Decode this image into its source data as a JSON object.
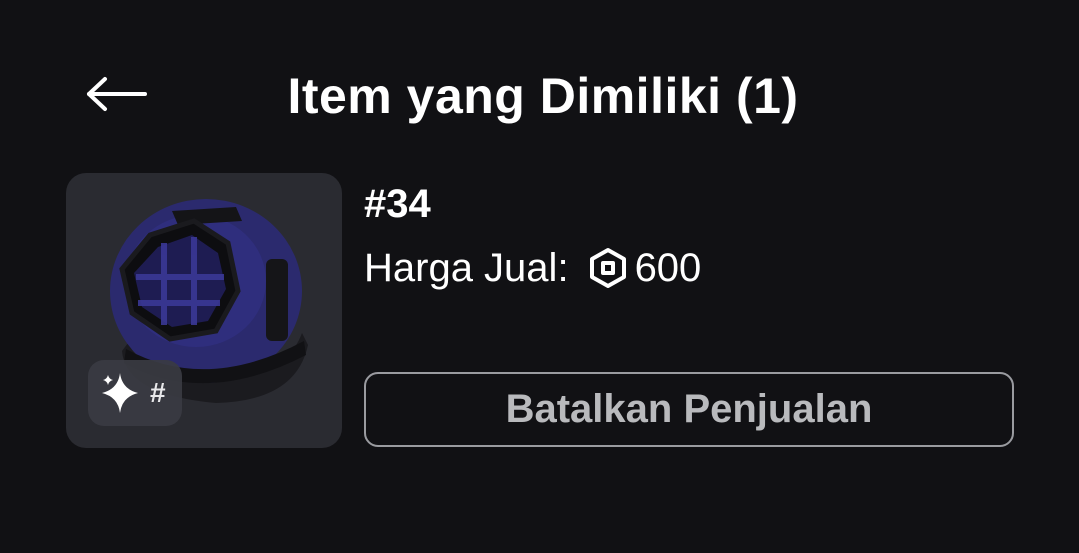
{
  "header": {
    "back_icon": "arrow-left-icon",
    "title": "Item yang Dimiliki (1)"
  },
  "item": {
    "thumbnail_icon": "diving-helmet-image",
    "badge_icon": "sparkle-icon",
    "badge_text": "#",
    "serial": "#34",
    "price_label": "Harga Jual:",
    "currency_icon": "robux-icon",
    "price_value": "600"
  },
  "actions": {
    "cancel_label": "Batalkan Penjualan"
  },
  "colors": {
    "background": "#111114",
    "card": "#2a2b31",
    "text": "#ffffff",
    "button_border": "#9a9ba0",
    "button_text": "#b9babd"
  }
}
